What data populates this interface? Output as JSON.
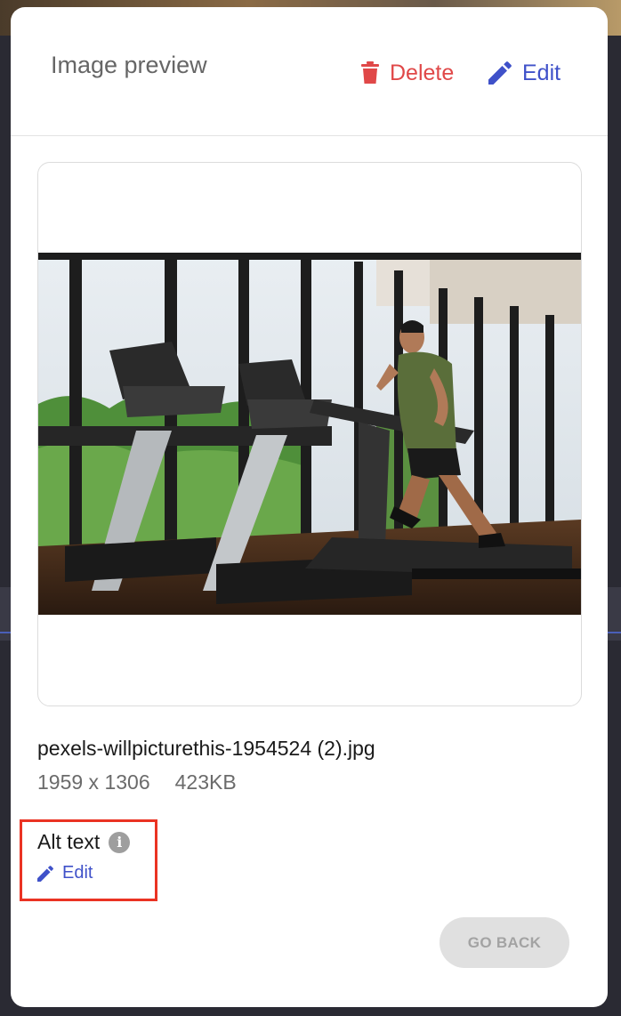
{
  "modal": {
    "title": "Image preview",
    "delete_label": "Delete",
    "edit_label": "Edit",
    "delete_icon": "trash-icon",
    "edit_icon": "pencil-icon"
  },
  "image": {
    "description_icon": "treadmill-gym-photo",
    "filename": "pexels-willpicturethis-1954524 (2).jpg",
    "dimensions": "1959 x 1306",
    "size": "423KB"
  },
  "alt_text": {
    "label": "Alt text",
    "info_icon": "info-icon",
    "edit_label": "Edit"
  },
  "footer": {
    "go_back_label": "GO BACK"
  },
  "colors": {
    "delete": "#e04848",
    "accent": "#3f51c9",
    "highlight": "#ea3323"
  }
}
